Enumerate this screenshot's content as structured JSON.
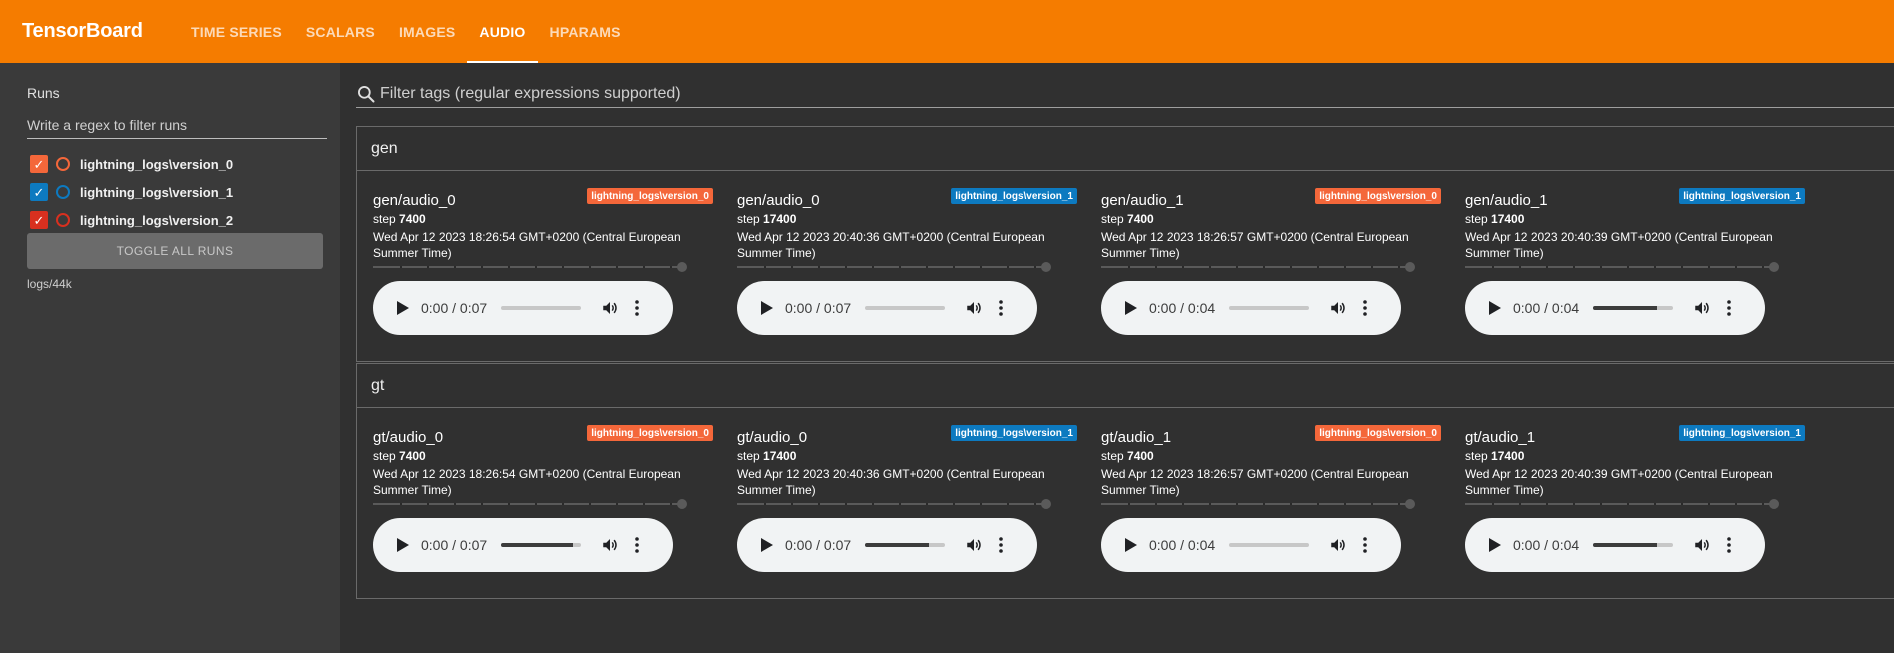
{
  "app": {
    "title": "TensorBoard"
  },
  "nav": {
    "tabs": [
      {
        "label": "TIME SERIES",
        "active": false
      },
      {
        "label": "SCALARS",
        "active": false
      },
      {
        "label": "IMAGES",
        "active": false
      },
      {
        "label": "AUDIO",
        "active": true
      },
      {
        "label": "HPARAMS",
        "active": false
      }
    ]
  },
  "colors": {
    "header": "#f57c00",
    "run0": "#f4673a",
    "run1": "#0d7ac0",
    "run2": "#d8301f"
  },
  "sidebar": {
    "runs_title": "Runs",
    "filter_placeholder": "Write a regex to filter runs",
    "runs": [
      {
        "name": "lightning_logs\\version_0",
        "checked": true,
        "color": "#f4673a"
      },
      {
        "name": "lightning_logs\\version_1",
        "checked": true,
        "color": "#0d7ac0"
      },
      {
        "name": "lightning_logs\\version_2",
        "checked": true,
        "color": "#d8301f"
      }
    ],
    "toggle_all_label": "TOGGLE ALL RUNS",
    "logdir": "logs/44k"
  },
  "main": {
    "search_placeholder": "Filter tags (regular expressions supported)",
    "groups": [
      {
        "name": "gen",
        "cards": [
          {
            "title": "gen/audio_0",
            "run": "lightning_logs\\version_0",
            "run_color": "#f4673a",
            "step_label": "step",
            "step": "7400",
            "time": "Wed Apr 12 2023 18:26:54 GMT+0200 (Central European Summer Time)",
            "player_time": "0:00 / 0:07",
            "volume": 0.0
          },
          {
            "title": "gen/audio_0",
            "run": "lightning_logs\\version_1",
            "run_color": "#0d7ac0",
            "step_label": "step",
            "step": "17400",
            "time": "Wed Apr 12 2023 20:40:36 GMT+0200 (Central European Summer Time)",
            "player_time": "0:00 / 0:07",
            "volume": 0.0
          },
          {
            "title": "gen/audio_1",
            "run": "lightning_logs\\version_0",
            "run_color": "#f4673a",
            "step_label": "step",
            "step": "7400",
            "time": "Wed Apr 12 2023 18:26:57 GMT+0200 (Central European Summer Time)",
            "player_time": "0:00 / 0:04",
            "volume": 0.0
          },
          {
            "title": "gen/audio_1",
            "run": "lightning_logs\\version_1",
            "run_color": "#0d7ac0",
            "step_label": "step",
            "step": "17400",
            "time": "Wed Apr 12 2023 20:40:39 GMT+0200 (Central European Summer Time)",
            "player_time": "0:00 / 0:04",
            "volume": 0.8
          }
        ]
      },
      {
        "name": "gt",
        "cards": [
          {
            "title": "gt/audio_0",
            "run": "lightning_logs\\version_0",
            "run_color": "#f4673a",
            "step_label": "step",
            "step": "7400",
            "time": "Wed Apr 12 2023 18:26:54 GMT+0200 (Central European Summer Time)",
            "player_time": "0:00 / 0:07",
            "volume": 0.9
          },
          {
            "title": "gt/audio_0",
            "run": "lightning_logs\\version_1",
            "run_color": "#0d7ac0",
            "step_label": "step",
            "step": "17400",
            "time": "Wed Apr 12 2023 20:40:36 GMT+0200 (Central European Summer Time)",
            "player_time": "0:00 / 0:07",
            "volume": 0.8
          },
          {
            "title": "gt/audio_1",
            "run": "lightning_logs\\version_0",
            "run_color": "#f4673a",
            "step_label": "step",
            "step": "7400",
            "time": "Wed Apr 12 2023 18:26:57 GMT+0200 (Central European Summer Time)",
            "player_time": "0:00 / 0:04",
            "volume": 0.0
          },
          {
            "title": "gt/audio_1",
            "run": "lightning_logs\\version_1",
            "run_color": "#0d7ac0",
            "step_label": "step",
            "step": "17400",
            "time": "Wed Apr 12 2023 20:40:39 GMT+0200 (Central European Summer Time)",
            "player_time": "0:00 / 0:04",
            "volume": 0.8
          }
        ]
      }
    ]
  }
}
